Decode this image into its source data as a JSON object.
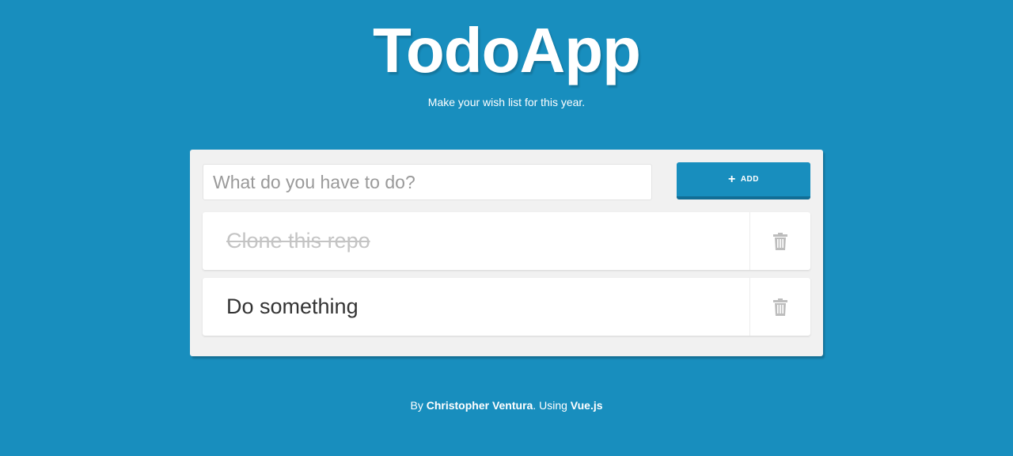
{
  "header": {
    "title": "TodoApp",
    "subtitle": "Make your wish list for this year."
  },
  "new_todo": {
    "placeholder": "What do you have to do?",
    "value": ""
  },
  "add_button": {
    "icon": "plus-icon",
    "label": "ADD"
  },
  "todos": [
    {
      "text": "Clone this repo",
      "completed": true,
      "delete_icon": "trash-icon"
    },
    {
      "text": "Do something",
      "completed": false,
      "delete_icon": "trash-icon"
    }
  ],
  "footer": {
    "prefix": "By ",
    "author": "Christopher Ventura",
    "middle": ". Using ",
    "framework": "Vue.js"
  },
  "colors": {
    "background": "#188ebe",
    "card": "#f1f1f1",
    "done_text": "#c4c4c4",
    "icon_gray": "#bdbdbd"
  }
}
